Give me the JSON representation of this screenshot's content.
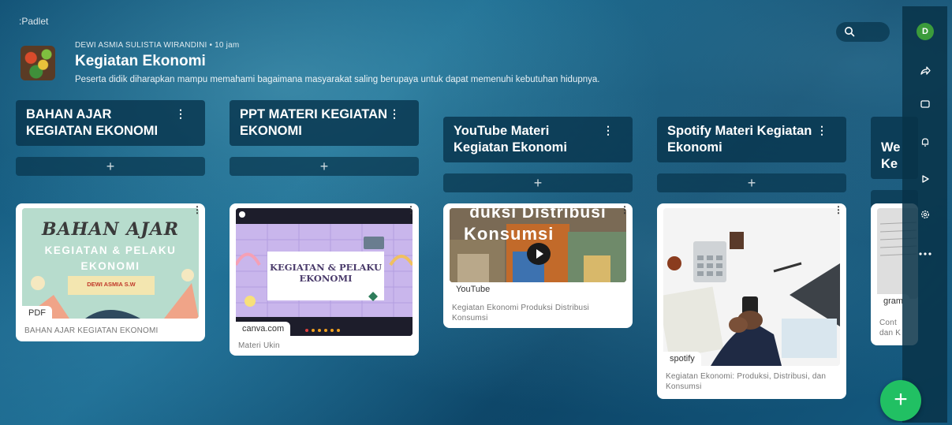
{
  "app": {
    "logo": ":Padlet"
  },
  "board": {
    "author_time": "DEWI ASMIA SULISTIA WIRANDINI • 10 jam",
    "title": "Kegiatan Ekonomi",
    "description": "Peserta didik diharapkan mampu memahami bagaimana masyarakat saling berupaya untuk dapat memenuhi kebutuhan hidupnya."
  },
  "user": {
    "initial": "D",
    "avatar_color": "#3b9b3b"
  },
  "rail_icons": [
    "share-icon",
    "remake-icon",
    "notification-bell-icon",
    "slideshow-play-icon",
    "settings-gear-icon",
    "more-options-icon"
  ],
  "columns": [
    {
      "title": "BAHAN AJAR KEGIATAN EKONOMI"
    },
    {
      "title": "PPT MATERI KEGIATAN EKONOMI"
    },
    {
      "title": "YouTube Materi Kegiatan Ekonomi"
    },
    {
      "title": "Spotify Materi Kegiatan Ekonomi"
    },
    {
      "title": "We\nKe"
    }
  ],
  "add_label": "+",
  "cards": [
    {
      "thumb_title": "BAHAN AJAR",
      "thumb_sub": "KEGIATAN & PELAKU EKONOMI",
      "thumb_author": "DEWI ASMIA S.W",
      "source": "PDF",
      "caption": "BAHAN AJAR KEGIATAN EKONOMI"
    },
    {
      "thumb_title": "KEGIATAN & PELAKU EKONOMI",
      "source": "canva.com",
      "caption": "Materi Ukin"
    },
    {
      "thumb_top": "duksi Distribusi",
      "thumb_title": "Konsumsi",
      "source": "YouTube",
      "caption": "Kegiatan Ekonomi Produksi Distribusi Konsumsi"
    },
    {
      "source": "spotify",
      "caption": "Kegiatan Ekonomi: Produksi, Distribusi, dan Konsumsi"
    },
    {
      "source": "gram",
      "caption": "Cont\ndan K"
    }
  ],
  "colors": {
    "accent_fab": "#21c063",
    "column_bg": "#08364e"
  },
  "fab_label": "+"
}
